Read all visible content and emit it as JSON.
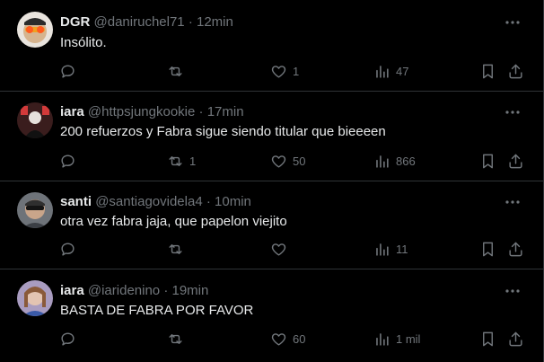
{
  "tweets": [
    {
      "name": "DGR",
      "handle": "@daniruchel71",
      "separator": "·",
      "time": "12min",
      "text": "Insólito.",
      "replies": "",
      "retweets": "",
      "likes": "1",
      "views": "47",
      "avatar_color": "#d9c7b0"
    },
    {
      "name": "iara",
      "handle": "@httpsjungkookie",
      "separator": "·",
      "time": "17min",
      "text": "200 refuerzos y Fabra sigue siendo titular que bieeeen",
      "replies": "",
      "retweets": "1",
      "likes": "50",
      "views": "866",
      "avatar_color": "#4a2a2a"
    },
    {
      "name": "santi",
      "handle": "@santiagovidela4",
      "separator": "·",
      "time": "10min",
      "text": "otra vez fabra jaja, que papelon viejito",
      "replies": "",
      "retweets": "",
      "likes": "",
      "views": "11",
      "avatar_color": "#8a8f96"
    },
    {
      "name": "iara",
      "handle": "@iaridenino",
      "separator": "·",
      "time": "19min",
      "text": "BASTA DE FABRA POR FAVOR",
      "replies": "",
      "retweets": "",
      "likes": "60",
      "views": "1 mil",
      "avatar_color": "#b7a9c9"
    }
  ],
  "colors": {
    "background": "#000000",
    "text": "#e7e9ea",
    "muted": "#71767b",
    "divider": "#2f3336"
  },
  "icons": [
    "more-icon",
    "reply-icon",
    "retweet-icon",
    "like-icon",
    "views-icon",
    "bookmark-icon",
    "share-icon"
  ]
}
